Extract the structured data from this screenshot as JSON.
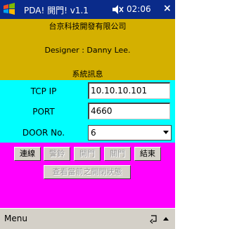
{
  "titlebar": {
    "title": "PDA! 開門! v1.1",
    "time": "02:06",
    "close_glyph": "×",
    "start_icon": "windows-flag-icon",
    "volume_icon": "speaker-volume-icon"
  },
  "info": {
    "company": "台京科技開發有限公司",
    "designer": "Designer : Danny Lee.",
    "section_title": "系統訊息"
  },
  "form": {
    "tcp_ip_label": "TCP IP",
    "tcp_ip_value": "10.10.10.101",
    "port_label": "PORT",
    "port_value": "4660",
    "door_label": "DOOR No.",
    "door_value": "6"
  },
  "actions": {
    "connect": "連線",
    "alarm": "警鈴",
    "open1": "開門",
    "open2": "關門",
    "exit": "結束",
    "status": "查看當前之開閉狀態"
  },
  "menubar": {
    "menu_label": "Menu"
  },
  "colors": {
    "titlebar": "#0a2b8a",
    "info_bg": "#d4b000",
    "form_bg": "#00ffff",
    "actions_bg": "#ff00ff",
    "button_face": "#d4d0c8"
  }
}
